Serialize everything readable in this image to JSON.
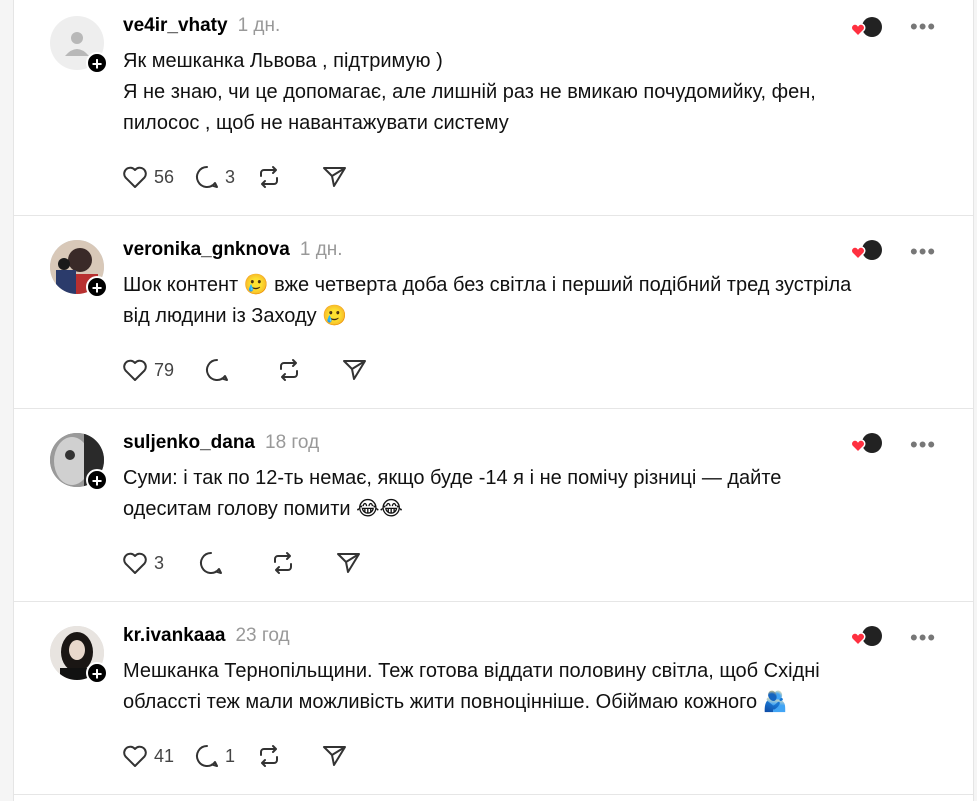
{
  "posts": [
    {
      "username": "ve4ir_vhaty",
      "time": "1 дн.",
      "lines": [
        "Як мешканка Львова , підтримую )",
        "Я не знаю, чи це допомагає, але лишній раз не вмикаю почудомийку, фен,",
        "пилосос , щоб не навантажувати систему"
      ],
      "likes": "56",
      "replies": "3",
      "avatar_style": "placeholder"
    },
    {
      "username": "veronika_gnknova",
      "time": "1 дн.",
      "lines": [
        "Шок контент 🥲 вже четверта доба без світла і перший подібний тред зустріла",
        "від людини із Заходу 🥲"
      ],
      "likes": "79",
      "replies": "",
      "avatar_style": "photo-colorful"
    },
    {
      "username": "suljenko_dana",
      "time": "18 год",
      "lines": [
        "Суми: і так по 12-ть немає, якщо буде -14 я і не помічу різниці — дайте",
        "одеситам голову помити 😂😂"
      ],
      "likes": "3",
      "replies": "",
      "avatar_style": "photo-grey"
    },
    {
      "username": "kr.ivankaaa",
      "time": "23 год",
      "lines": [
        "Мешканка Тернопільщини. Теж готова віддати половину світла, щоб Східні",
        "облассті теж мали можливість жити повноцінніше. Обіймаю кожного 🫂"
      ],
      "likes": "41",
      "replies": "1",
      "avatar_style": "photo-dark"
    }
  ],
  "icons": {
    "like": "heart-icon",
    "reply": "comment-icon",
    "repost": "repost-icon",
    "share": "send-icon",
    "more": "more-icon",
    "plus": "follow-plus-icon"
  },
  "more_glyph": "•••",
  "plus_glyph": "+",
  "colors": {
    "heart": "#ff3040",
    "divider": "#e6e6e6",
    "muted": "#999999"
  }
}
